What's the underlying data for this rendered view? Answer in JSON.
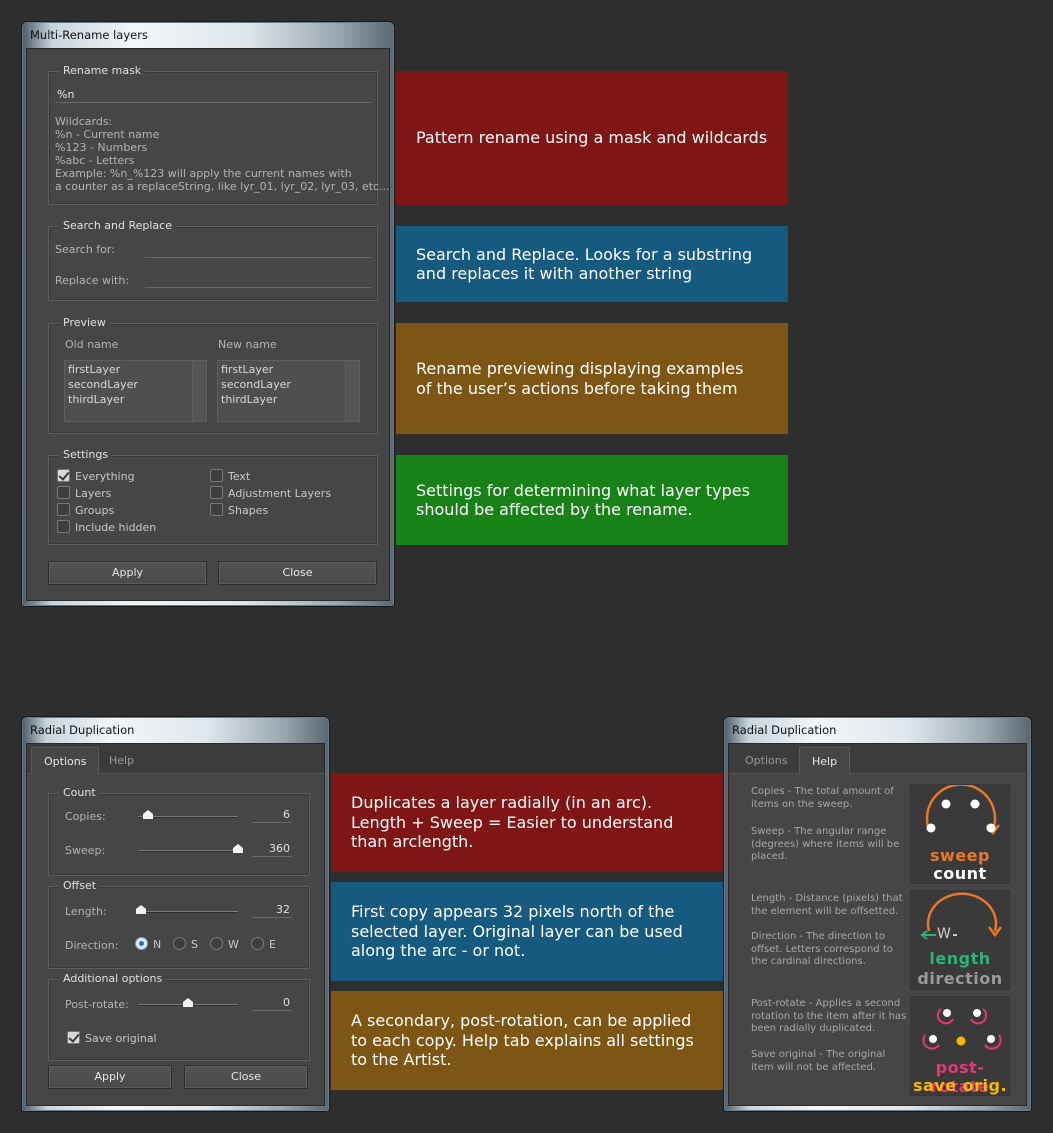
{
  "colors": {
    "red": "#7f1515",
    "blue": "#175a80",
    "brown": "#7d5515",
    "green": "#188218",
    "sweep": "#e8772a",
    "length": "#2db37a",
    "postrotate": "#e8357a",
    "saveorig": "#f5b800"
  },
  "rename": {
    "title": "Multi-Rename layers",
    "mask": {
      "group": "Rename mask",
      "value": "%n",
      "wildcards": "Wildcards:",
      "w1": "%n - Current name",
      "w2": "%123 - Numbers",
      "w3": "%abc - Letters",
      "w4": "Example: %n_%123 will apply the current names with",
      "w5": "a counter as a replaceString, like lyr_01, lyr_02, lyr_03, etc..."
    },
    "search": {
      "group": "Search and Replace",
      "search_label": "Search for:",
      "replace_label": "Replace with:"
    },
    "preview": {
      "group": "Preview",
      "old_label": "Old name",
      "new_label": "New name",
      "old_items": [
        "firstLayer",
        "secondLayer",
        "thirdLayer"
      ],
      "new_items": [
        "firstLayer",
        "secondLayer",
        "thirdLayer"
      ]
    },
    "settings": {
      "group": "Settings",
      "everything": "Everything",
      "layers": "Layers",
      "groups": "Groups",
      "include_hidden": "Include hidden",
      "text": "Text",
      "adjustment": "Adjustment Layers",
      "shapes": "Shapes"
    },
    "apply": "Apply",
    "close": "Close"
  },
  "radial": {
    "title": "Radial Duplication",
    "tab_options": "Options",
    "tab_help": "Help",
    "count_group": "Count",
    "copies_label": "Copies:",
    "copies_value": "6",
    "copies_level": 0.1,
    "sweep_label": "Sweep:",
    "sweep_value": "360",
    "sweep_level": 1.0,
    "offset_group": "Offset",
    "length_label": "Length:",
    "length_value": "32",
    "length_level": 0.03,
    "direction_label": "Direction:",
    "dir_n": "N",
    "dir_s": "S",
    "dir_w": "W",
    "dir_e": "E",
    "additional_group": "Additional options",
    "postrotate_label": "Post-rotate:",
    "postrotate_value": "0",
    "postrotate_level": 0.5,
    "save_original": "Save original",
    "apply": "Apply",
    "close": "Close"
  },
  "help": {
    "title": "Radial Duplication",
    "tab_options": "Options",
    "tab_help": "Help",
    "t1": "Copies - The total amount of\nitems on the sweep.",
    "t2": "Sweep - The angular range\n(degrees) where items will be\nplaced.",
    "t3": "Length - Distance (pixels) that\nthe element will be offsetted.",
    "t4": "Direction - The direction to\noffset. Letters correspond to\nthe cardinal directions.",
    "t5": "Post-rotate - Applies a second\nrotation to the item after it has\nbeen radially duplicated.",
    "t6": "Save original - The original\nitem will not be affected.",
    "w_sweep": "sweep",
    "w_count": "count",
    "w_length": "length",
    "w_direction": "direction",
    "w_w": "W",
    "w_postrotate": "post-rotate",
    "w_saveorig": "save orig."
  },
  "annotations": {
    "a1": "Pattern rename using a mask and wildcards",
    "a2": "Search and Replace. Looks for a substring\nand replaces it with another string",
    "a3": "Rename previewing displaying examples\nof the user’s actions before taking them",
    "a4": "Settings for determining what layer types\nshould be affected by the rename.",
    "a5": "Duplicates a layer radially (in an arc).\nLength + Sweep = Easier to understand\nthan arclength.",
    "a6": "First copy appears 32 pixels north of the\nselected layer. Original layer can be used\nalong the arc - or not.",
    "a7": "A secondary, post-rotation, can be applied\nto each copy. Help tab explains all settings\nto the Artist."
  }
}
